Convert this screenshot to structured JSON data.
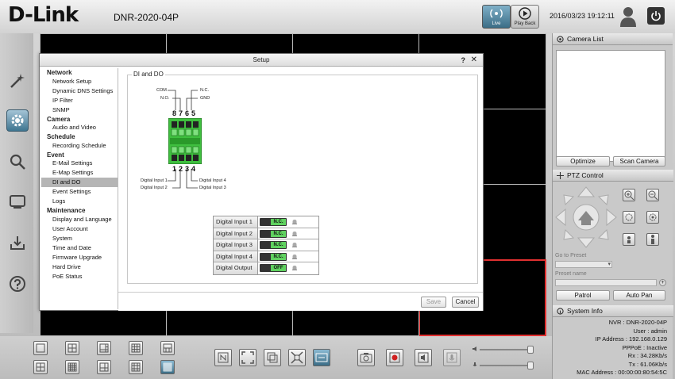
{
  "header": {
    "brand": "D-Link",
    "model": "DNR-2020-04P",
    "live_label": "Live",
    "playback_label": "Play Back",
    "datetime": "2016/03/23  19:12:11"
  },
  "left_nav": {
    "items": [
      {
        "icon": "wizard-icon"
      },
      {
        "icon": "setup-gear-icon",
        "active": true
      },
      {
        "icon": "search-icon"
      },
      {
        "icon": "display-icon"
      },
      {
        "icon": "download-icon"
      },
      {
        "icon": "help-icon"
      }
    ]
  },
  "setup": {
    "title": "Setup",
    "help": "?",
    "close": "✕",
    "menu": [
      {
        "type": "group",
        "label": "Network"
      },
      {
        "type": "item",
        "label": "Network Setup"
      },
      {
        "type": "item",
        "label": "Dynamic DNS Settings"
      },
      {
        "type": "item",
        "label": "IP Filter"
      },
      {
        "type": "item",
        "label": "SNMP"
      },
      {
        "type": "group",
        "label": "Camera"
      },
      {
        "type": "item",
        "label": "Audio and Video"
      },
      {
        "type": "group",
        "label": "Schedule"
      },
      {
        "type": "item",
        "label": "Recording Schedule"
      },
      {
        "type": "group",
        "label": "Event"
      },
      {
        "type": "item",
        "label": "E-Mail Settings"
      },
      {
        "type": "item",
        "label": "E-Map Settings"
      },
      {
        "type": "item",
        "label": "DI and DO",
        "active": true
      },
      {
        "type": "item",
        "label": "Event Settings"
      },
      {
        "type": "item",
        "label": "Logs"
      },
      {
        "type": "group",
        "label": "Maintenance"
      },
      {
        "type": "item",
        "label": "Display and Language"
      },
      {
        "type": "item",
        "label": "User Account"
      },
      {
        "type": "item",
        "label": "System"
      },
      {
        "type": "item",
        "label": "Time and Date"
      },
      {
        "type": "item",
        "label": "Firmware Upgrade"
      },
      {
        "type": "item",
        "label": "Hard Drive"
      },
      {
        "type": "item",
        "label": "PoE Status"
      }
    ],
    "section_title": "DI and DO",
    "diagram": {
      "top_labels": {
        "com": "COM",
        "no": "N.O.",
        "nc": "N.C.",
        "gnd": "GND"
      },
      "top_pins": [
        "8",
        "7",
        "6",
        "5"
      ],
      "bottom_pins": [
        "1",
        "2",
        "3",
        "4"
      ],
      "bottom_labels": {
        "di1": "Digital Input 1",
        "di2": "Digital Input 2",
        "di3": "Digital Input 3",
        "di4": "Digital Input 4"
      }
    },
    "io_rows": [
      {
        "label": "Digital Input 1",
        "state": "N.C."
      },
      {
        "label": "Digital Input 2",
        "state": "N.C."
      },
      {
        "label": "Digital Input 3",
        "state": "N.C."
      },
      {
        "label": "Digital Input 4",
        "state": "N.C."
      },
      {
        "label": "Digital Output",
        "state": "OFF"
      }
    ],
    "save_label": "Save",
    "cancel_label": "Cancel"
  },
  "right_panel": {
    "camera_list_title": "Camera List",
    "optimize_label": "Optimize",
    "scan_camera_label": "Scan Camera",
    "ptz_title": "PTZ Control",
    "goto_preset_label": "Go to Preset",
    "preset_name_label": "Preset name",
    "patrol_label": "Patrol",
    "auto_pan_label": "Auto Pan",
    "system_info_title": "System Info",
    "system_info": [
      {
        "key": "NVR",
        "value": "DNR-2020-04P"
      },
      {
        "key": "User",
        "value": "admin"
      },
      {
        "key": "IP Address",
        "value": "192.168.0.129"
      },
      {
        "key": "PPPoE",
        "value": "Inactive"
      },
      {
        "key": "Rx",
        "value": "34.28Kb/s"
      },
      {
        "key": "Tx",
        "value": "61.06Kb/s"
      },
      {
        "key": "MAC Address",
        "value": "00:00:00:80:54:5C"
      }
    ]
  },
  "colors": {
    "accent_blue": "#3b6d86",
    "selected_cell": "#e03030",
    "switch_on": "#5fd15f",
    "terminal_green": "#3fbf3f"
  }
}
